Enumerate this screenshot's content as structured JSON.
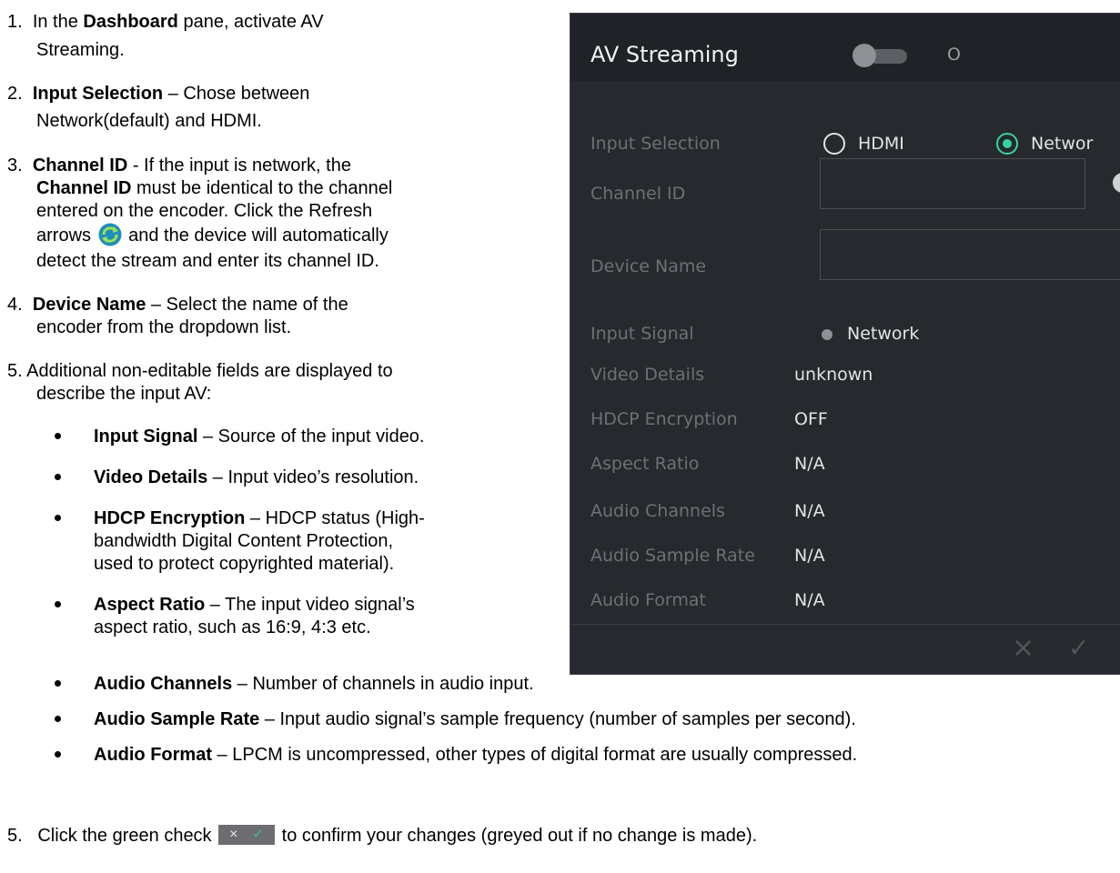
{
  "doc": {
    "step1": {
      "num": "1.",
      "a": "In the ",
      "b": "Dashboard",
      "c": " pane, activate AV",
      "d": "Streaming."
    },
    "step2": {
      "num": "2.",
      "b": "Input Selection",
      "c": " – Chose between",
      "d": "Network(default) and HDMI."
    },
    "step3": {
      "num": "3.",
      "b1": "Channel ID",
      "c1": " - If the input is network, the",
      "b2": "Channel ID",
      "c2": " must be identical to the channel",
      "l3": "entered on the encoder. Click the Refresh",
      "l4a": "arrows",
      "l4b": " and the device will automatically",
      "l5": "detect the stream and enter its channel ID."
    },
    "step4": {
      "num": "4.",
      "b": "Device Name",
      "c": " – Select the name of the",
      "d": "encoder from the dropdown list."
    },
    "step5a": {
      "l1": "5. Additional non-editable fields are displayed to",
      "l2": "describe the input AV:"
    },
    "bullets": {
      "input_signal": {
        "b": "Input Signal",
        "c": " – Source of the input video."
      },
      "video_details": {
        "b": "Video Details",
        "c": " – Input video’s resolution."
      },
      "hdcp": {
        "b": "HDCP Encryption",
        "c": " – HDCP status (High-",
        "l2": "bandwidth Digital Content Protection,",
        "l3": "used to protect copyrighted material)."
      },
      "aspect": {
        "b": "Aspect Ratio",
        "c": " – The input video signal’s",
        "l2": "aspect ratio, such as 16:9, 4:3 etc."
      },
      "audio_channels": {
        "b": "Audio Channels",
        "c": " – Number of channels in audio input."
      },
      "audio_sample_rate": {
        "b": "Audio Sample Rate",
        "c": " – Input audio signal’s sample frequency (number of samples per second)."
      },
      "audio_format": {
        "b": "Audio Format",
        "c": " – LPCM is uncompressed, other types of digital format are usually compressed."
      }
    },
    "step5b": {
      "num": "5.",
      "a": "Click the green check",
      "c": " to confirm your changes (greyed out if no change is made)."
    },
    "mini_bar": {
      "x": "×",
      "check": "✓"
    }
  },
  "panel": {
    "title": "AV Streaming",
    "toggle_label": "O",
    "toggle_on": false,
    "input_selection": {
      "label": "Input Selection",
      "options": [
        {
          "label": "HDMI",
          "selected": false
        },
        {
          "label": "Networ",
          "selected": true
        }
      ]
    },
    "channel_id": {
      "label": "Channel ID",
      "value": ""
    },
    "device_name": {
      "label": "Device Name",
      "value": ""
    },
    "info": [
      {
        "label": "Input Signal",
        "value": "Network"
      },
      {
        "label": "Video Details",
        "value": "unknown"
      },
      {
        "label": "HDCP Encryption",
        "value": "OFF"
      },
      {
        "label": "Aspect Ratio",
        "value": "N/A"
      },
      {
        "label": "Audio Channels",
        "value": "N/A"
      },
      {
        "label": "Audio Sample Rate",
        "value": "N/A"
      },
      {
        "label": "Audio Format",
        "value": "N/A"
      }
    ],
    "footer": {
      "cancel": "×",
      "confirm": "✓"
    },
    "colors": {
      "accent": "#35d59a",
      "panel_bg": "#26292d",
      "header_bg": "#1f2226",
      "label": "#6d7175",
      "value": "#e3e3e3"
    }
  }
}
